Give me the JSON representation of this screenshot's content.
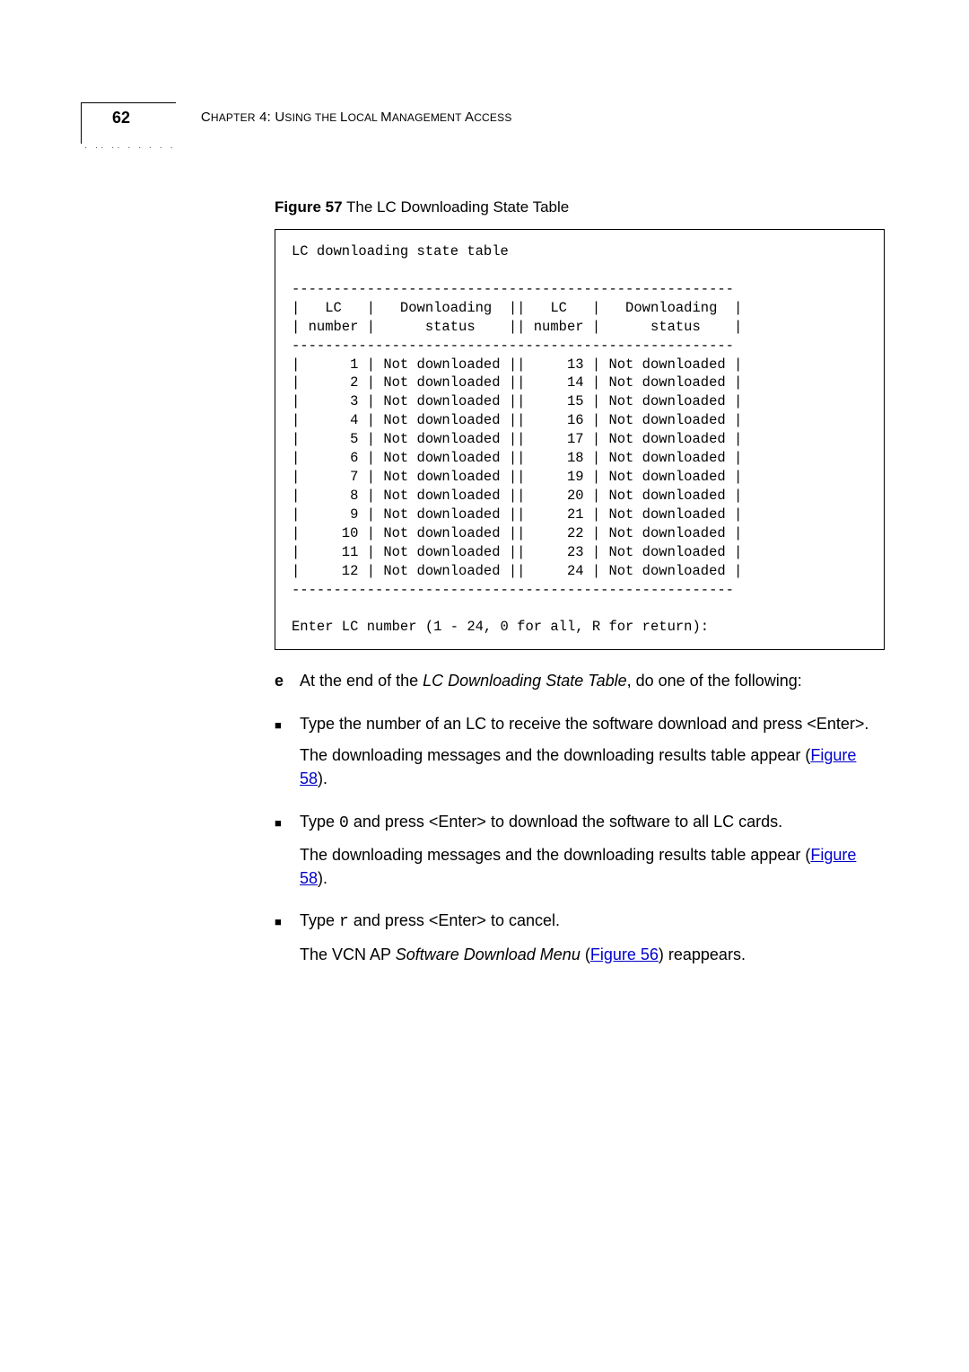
{
  "header": {
    "page_number": "62",
    "chapter_prefix": "C",
    "chapter_small1": "HAPTER",
    "chapter_num": " 4: U",
    "chapter_small2": "SING THE ",
    "chapter_big2": "L",
    "chapter_small3": "OCAL ",
    "chapter_big3": "M",
    "chapter_small4": "ANAGEMENT ",
    "chapter_big4": "A",
    "chapter_small5": "CCESS"
  },
  "figure": {
    "label": "Figure 57",
    "title": "   The LC Downloading State Table"
  },
  "code": {
    "title": "LC downloading state table",
    "hr1": "-----------------------------------------------------",
    "hdr1": "|   LC   |   Downloading  ||   LC   |   Downloading  |",
    "hdr2": "| number |      status    || number |      status    |",
    "hr2": "-----------------------------------------------------",
    "rows": [
      "|      1 | Not downloaded ||     13 | Not downloaded |",
      "|      2 | Not downloaded ||     14 | Not downloaded |",
      "|      3 | Not downloaded ||     15 | Not downloaded |",
      "|      4 | Not downloaded ||     16 | Not downloaded |",
      "|      5 | Not downloaded ||     17 | Not downloaded |",
      "|      6 | Not downloaded ||     18 | Not downloaded |",
      "|      7 | Not downloaded ||     19 | Not downloaded |",
      "|      8 | Not downloaded ||     20 | Not downloaded |",
      "|      9 | Not downloaded ||     21 | Not downloaded |",
      "|     10 | Not downloaded ||     22 | Not downloaded |",
      "|     11 | Not downloaded ||     23 | Not downloaded |",
      "|     12 | Not downloaded ||     24 | Not downloaded |"
    ],
    "hr3": "-----------------------------------------------------",
    "prompt": "Enter LC number (1 - 24, 0 for all, R for return):"
  },
  "steps": {
    "e_label": "e",
    "e_text1": "At the end of the ",
    "e_italic": "LC Downloading State Table",
    "e_text2": ", do one of the following:",
    "b1_pre": "Type the number of an LC to receive the software download and press <Enter>.",
    "b1_sub1": "The downloading messages and the downloading results table appear (",
    "b1_link": "Figure 58",
    "b1_sub2": ").",
    "b2_pre1": "Type ",
    "b2_code": "0",
    "b2_pre2": " and press <Enter> to download the software to all LC cards.",
    "b2_sub1": "The downloading messages and the downloading results table appear (",
    "b2_link": "Figure 58",
    "b2_sub2": ").",
    "b3_pre1": "Type ",
    "b3_code": "r",
    "b3_pre2": " and press <Enter> to cancel.",
    "b3_sub1": "The VCN AP ",
    "b3_italic": "Software Download Menu",
    "b3_sub2": " (",
    "b3_link": "Figure 56",
    "b3_sub3": ") reappears."
  },
  "bullet": "■"
}
